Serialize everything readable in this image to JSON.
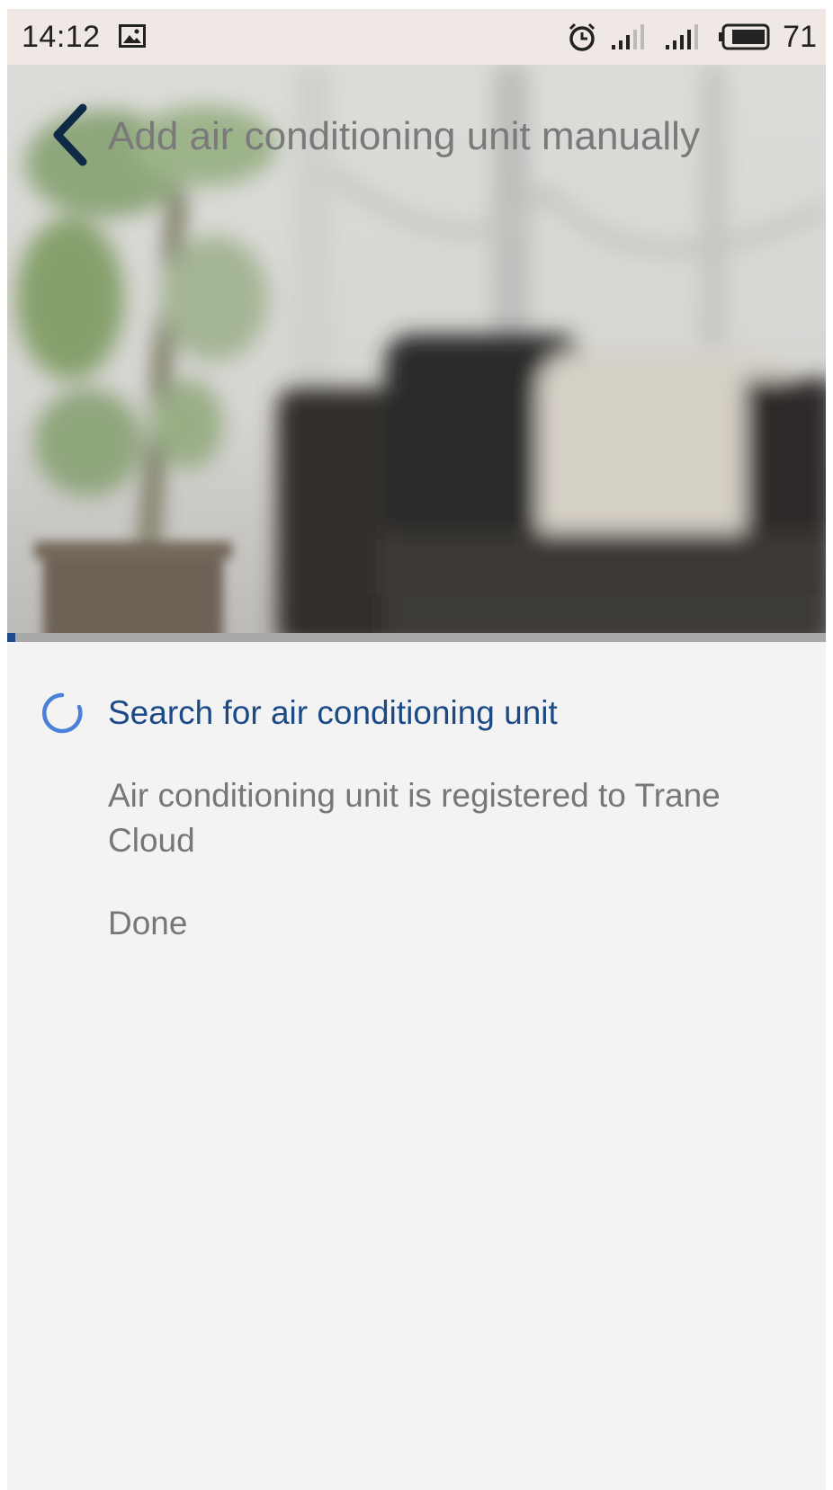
{
  "status_bar": {
    "time": "14:12",
    "battery": "71",
    "icons": [
      "gallery-icon",
      "alarm-icon",
      "signal-icon",
      "signal-icon",
      "battery-icon"
    ]
  },
  "header": {
    "title": "Add air conditioning unit manually",
    "back_icon": "chevron-left-icon"
  },
  "progress": {
    "value": 0.01,
    "color": "#1d4a8a"
  },
  "steps": [
    {
      "label": "Search for air conditioning unit",
      "state": "active",
      "icon": "spinner-icon"
    },
    {
      "label": "Air conditioning unit is registered to Trane Cloud",
      "state": "pending"
    },
    {
      "label": "Done",
      "state": "pending"
    }
  ],
  "colors": {
    "accent": "#1b4a86",
    "spinner": "#4a80d8",
    "background": "#f3f3f3"
  }
}
